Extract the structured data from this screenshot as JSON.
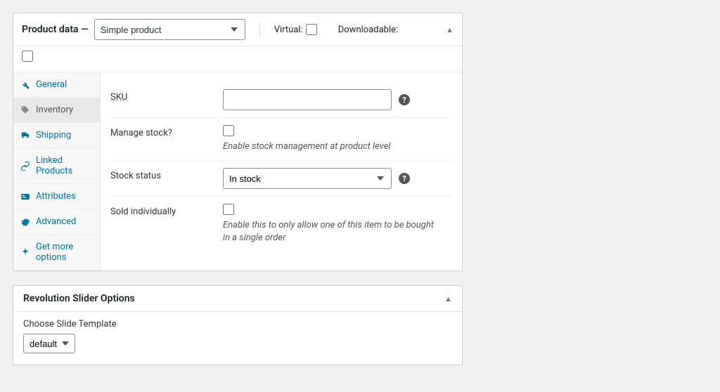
{
  "product_panel": {
    "title": "Product data —",
    "product_type": "Simple product",
    "virtual_label": "Virtual:",
    "downloadable_label": "Downloadable:",
    "tabs": {
      "general": "General",
      "inventory": "Inventory",
      "shipping": "Shipping",
      "linked": "Linked Products",
      "attributes": "Attributes",
      "advanced": "Advanced",
      "get_more": "Get more options"
    },
    "fields": {
      "sku_label": "SKU",
      "sku_value": "",
      "manage_stock_label": "Manage stock?",
      "manage_stock_hint": "Enable stock management at product level",
      "stock_status_label": "Stock status",
      "stock_status_value": "In stock",
      "sold_individually_label": "Sold individually",
      "sold_individually_hint": "Enable this to only allow one of this item to be bought in a single order"
    }
  },
  "slider_panel": {
    "title": "Revolution Slider Options",
    "choose_label": "Choose Slide Template",
    "template_value": "default"
  }
}
